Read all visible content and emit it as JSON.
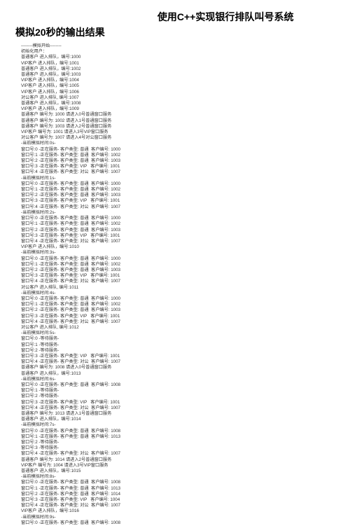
{
  "title": "使用C++实现银行排队叫号系统",
  "subtitle": "模拟20秒的输出结果",
  "log_lines": [
    "--------模拟开始--------",
    "初始化用户：",
    "普通客户 进入排队，编号:1000",
    "VIP客户 进入排队，编号:1001",
    "普通客户 进入排队，编号:1002",
    "普通客户 进入排队，编号:1003",
    "VIP客户 进入排队，编号:1004",
    "VIP客户 进入排队，编号:1005",
    "VIP客户 进入排队，编号:1006",
    "对公客户 进入排队, 编号:1007",
    "普通客户 进入排队，编号:1008",
    "VIP客户 进入排队，编号:1009",
    "普通客户 编号为: 1000 请进入0号普通窗口服务",
    "普通客户 编号为: 1002 请进入1号普通窗口服务",
    "普通客户 编号为: 1003 请进入2号普通窗口服务",
    "VIP客户 编号为: 1001 请进入3号VIP窗口服务",
    "对公客户 编号为: 1007 请进入4号对公窗口服务",
    "-当前模拟时间:0s-",
    "窗口号:0 -正在服务- 客户类型: 普通  客户编号: 1000",
    "窗口号:1 -正在服务- 客户类型: 普通  客户编号: 1002",
    "窗口号:2 -正在服务- 客户类型: 普通  客户编号: 1003",
    "窗口号:3 -正在服务- 客户类型: VIP   客户编号: 1001",
    "窗口号:4 -正在服务- 客户类型: 对公  客户编号: 1007",
    "-当前模拟时间:1s-",
    "窗口号:0 -正在服务- 客户类型: 普通  客户编号: 1000",
    "窗口号:1 -正在服务- 客户类型: 普通  客户编号: 1002",
    "窗口号:2 -正在服务- 客户类型: 普通  客户编号: 1003",
    "窗口号:3 -正在服务- 客户类型: VIP   客户编号: 1001",
    "窗口号:4 -正在服务- 客户类型: 对公  客户编号: 1007",
    "-当前模拟时间:2s-",
    "窗口号:0 -正在服务- 客户类型: 普通  客户编号: 1000",
    "窗口号:1 -正在服务- 客户类型: 普通  客户编号: 1002",
    "窗口号:2 -正在服务- 客户类型: 普通  客户编号: 1003",
    "窗口号:3 -正在服务- 客户类型: VIP   客户编号: 1001",
    "窗口号:4 -正在服务- 客户类型: 对公  客户编号: 1007",
    "VIP客户 进入排队，编号:1010",
    "-当前模拟时间:3s-",
    "窗口号:0 -正在服务- 客户类型: 普通  客户编号: 1000",
    "窗口号:1 -正在服务- 客户类型: 普通  客户编号: 1002",
    "窗口号:2 -正在服务- 客户类型: 普通  客户编号: 1003",
    "窗口号:3 -正在服务- 客户类型: VIP   客户编号: 1001",
    "窗口号:4 -正在服务- 客户类型: 对公  客户编号: 1007",
    "对公客户 进入排队, 编号:1011",
    "-当前模拟时间:4s-",
    "窗口号:0 -正在服务- 客户类型: 普通  客户编号: 1000",
    "窗口号:1 -正在服务- 客户类型: 普通  客户编号: 1002",
    "窗口号:2 -正在服务- 客户类型: 普通  客户编号: 1003",
    "窗口号:3 -正在服务- 客户类型: VIP   客户编号: 1001",
    "窗口号:4 -正在服务- 客户类型: 对公  客户编号: 1007",
    "对公客户 进入排队, 编号:1012",
    "-当前模拟时间:5s-",
    "窗口号:0 -等待服务-",
    "窗口号:1 -等待服务-",
    "窗口号:2 -等待服务-",
    "窗口号:3 -正在服务- 客户类型: VIP   客户编号: 1001",
    "窗口号:4 -正在服务- 客户类型: 对公  客户编号: 1007",
    "普通客户 编号为: 1008 请进入0号普通窗口服务",
    "普通客户 进入排队，编号:1013",
    "-当前模拟时间:6s-",
    "窗口号:0 -正在服务- 客户类型: 普通  客户编号: 1008",
    "窗口号:1 -等待服务-",
    "窗口号:2 -等待服务-",
    "窗口号:3 -正在服务- 客户类型: VIP   客户编号: 1001",
    "窗口号:4 -正在服务- 客户类型: 对公  客户编号: 1007",
    "普通客户 编号为: 1013 请进入1号普通窗口服务",
    "普通客户 进入排队，编号:1014",
    "-当前模拟时间:7s-",
    "窗口号:0 -正在服务- 客户类型: 普通  客户编号: 1008",
    "窗口号:1 -正在服务- 客户类型: 普通  客户编号: 1013",
    "窗口号:2 -等待服务-",
    "窗口号:3 -等待服务-",
    "窗口号:4 -正在服务- 客户类型: 对公  客户编号: 1007",
    "普通客户 编号为: 1014 请进入2号普通窗口服务",
    "VIP客户 编号为: 1004 请进入3号VIP窗口服务",
    "普通客户 进入排队，编号:1015",
    "-当前模拟时间:8s-",
    "窗口号:0 -正在服务- 客户类型: 普通  客户编号: 1008",
    "窗口号:1 -正在服务- 客户类型: 普通  客户编号: 1013",
    "窗口号:2 -正在服务- 客户类型: 普通  客户编号: 1014",
    "窗口号:3 -正在服务- 客户类型: VIP   客户编号: 1004",
    "窗口号:4 -正在服务- 客户类型: 对公  客户编号: 1007",
    "VIP客户 进入排队，编号:1016",
    "-当前模拟时间:9s-",
    "窗口号:0 -正在服务- 客户类型: 普通  客户编号: 1008"
  ]
}
